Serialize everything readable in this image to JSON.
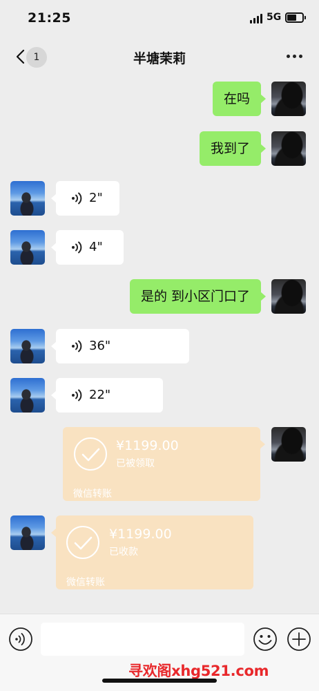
{
  "status_bar": {
    "time": "21:25",
    "network": "5G"
  },
  "header": {
    "back_count": "1",
    "title": "半塘茉莉"
  },
  "messages": [
    {
      "direction": "out",
      "type": "text",
      "text": "在吗"
    },
    {
      "direction": "out",
      "type": "text",
      "text": "我到了"
    },
    {
      "direction": "in",
      "type": "voice",
      "duration": "2\""
    },
    {
      "direction": "in",
      "type": "voice",
      "duration": "4\""
    },
    {
      "direction": "out",
      "type": "text",
      "text": "是的 到小区门口了"
    },
    {
      "direction": "in",
      "type": "voice",
      "duration": "36\""
    },
    {
      "direction": "in",
      "type": "voice",
      "duration": "22\""
    },
    {
      "direction": "out",
      "type": "transfer",
      "amount": "¥1199.00",
      "status": "已被领取",
      "footer": "微信转账"
    },
    {
      "direction": "in",
      "type": "transfer",
      "amount": "¥1199.00",
      "status": "已收款",
      "footer": "微信转账"
    }
  ],
  "input": {
    "value": ""
  },
  "watermark": "寻欢阁xhg521.com",
  "colors": {
    "background": "#ededed",
    "outgoing_bubble": "#95ec69",
    "incoming_bubble": "#ffffff",
    "transfer_bubble": "#f9e2c1",
    "watermark": "#e8282b"
  }
}
